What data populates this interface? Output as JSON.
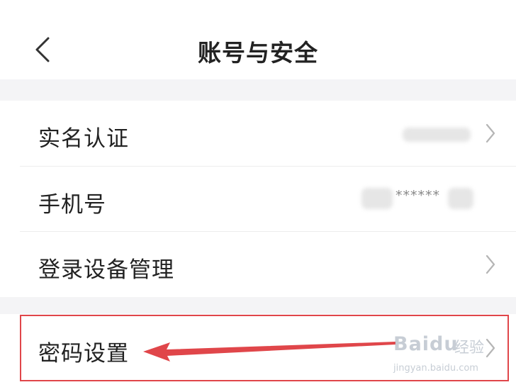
{
  "header": {
    "title": "账号与安全",
    "back_icon": "chevron-left-icon"
  },
  "rows": [
    {
      "label": "实名认证",
      "value": "",
      "has_chevron": true
    },
    {
      "label": "手机号",
      "value": "******",
      "has_chevron": false
    },
    {
      "label": "登录设备管理",
      "value": "",
      "has_chevron": true
    },
    {
      "label": "密码设置",
      "value": "",
      "has_chevron": true,
      "highlighted": true
    }
  ],
  "annotation": {
    "highlight_color": "#e0464a",
    "arrow_color": "#e0464a"
  },
  "watermark": {
    "brand": "Baidu",
    "cn": "经验",
    "url": "jingyan.baidu.com"
  }
}
